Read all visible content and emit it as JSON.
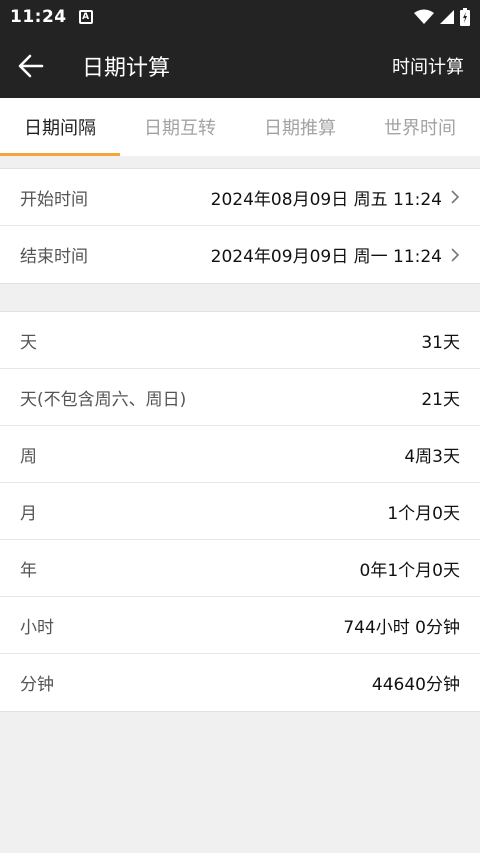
{
  "statusbar": {
    "time": "11:24",
    "notification_glyph": "A"
  },
  "appbar": {
    "title": "日期计算",
    "action": "时间计算"
  },
  "tabs": [
    {
      "label": "日期间隔",
      "active": true
    },
    {
      "label": "日期互转",
      "active": false
    },
    {
      "label": "日期推算",
      "active": false
    },
    {
      "label": "世界时间",
      "active": false
    }
  ],
  "range": {
    "start_label": "开始时间",
    "start_value": "2024年08月09日 周五 11:24",
    "end_label": "结束时间",
    "end_value": "2024年09月09日 周一 11:24"
  },
  "results": [
    {
      "label": "天",
      "value": "31天"
    },
    {
      "label": "天(不包含周六、周日)",
      "value": "21天"
    },
    {
      "label": "周",
      "value": "4周3天"
    },
    {
      "label": "月",
      "value": "1个月0天"
    },
    {
      "label": "年",
      "value": "0年1个月0天"
    },
    {
      "label": "小时",
      "value": "744小时 0分钟"
    },
    {
      "label": "分钟",
      "value": "44640分钟"
    }
  ],
  "colors": {
    "accent": "#f5a43b",
    "bar": "#232323"
  }
}
